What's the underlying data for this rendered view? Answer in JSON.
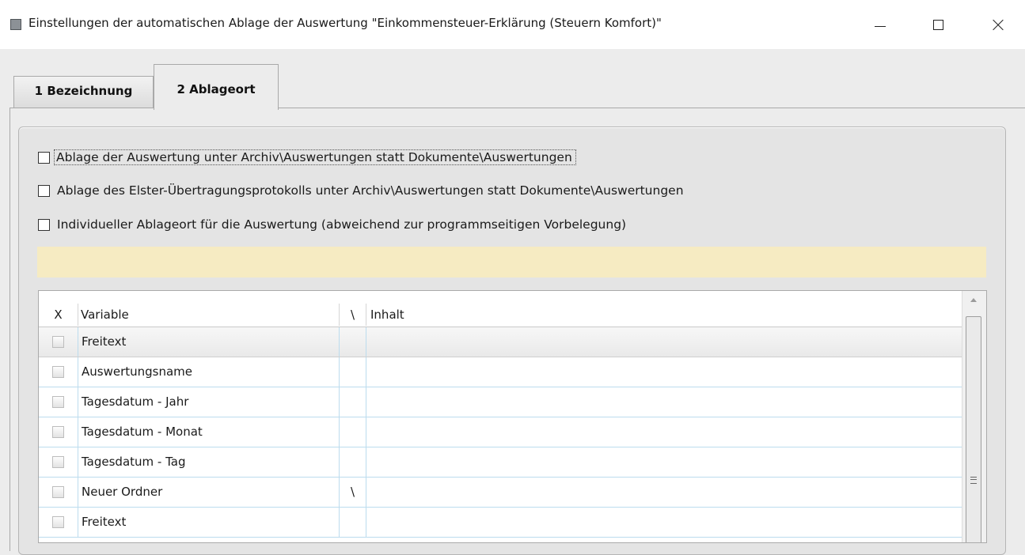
{
  "window": {
    "title": "Einstellungen der automatischen Ablage der Auswertung \"Einkommensteuer-Erklärung (Steuern Komfort)\"",
    "icon": "app-icon"
  },
  "tabs": [
    {
      "label": "1 Bezeichnung",
      "active": false
    },
    {
      "label": "2 Ablageort",
      "active": true
    }
  ],
  "options": [
    {
      "label": "Ablage der Auswertung unter Archiv\\Auswertungen statt Dokumente\\Auswertungen",
      "checked": false,
      "focused": true
    },
    {
      "label": "Ablage des Elster-Übertragungsprotokolls unter Archiv\\Auswertungen statt Dokumente\\Auswertungen",
      "checked": false
    },
    {
      "label": "Individueller Ablageort für die Auswertung (abweichend zur programmseitigen Vorbelegung)",
      "checked": false
    }
  ],
  "info_bar": {
    "text": "",
    "color": "#f6ebc2"
  },
  "table": {
    "columns": [
      "X",
      "Variable",
      "\\",
      "Inhalt"
    ],
    "rows": [
      {
        "checked": false,
        "variable": "Freitext",
        "sep": "",
        "inhalt": ""
      },
      {
        "checked": false,
        "variable": "Auswertungsname",
        "sep": "",
        "inhalt": ""
      },
      {
        "checked": false,
        "variable": "Tagesdatum - Jahr",
        "sep": "",
        "inhalt": ""
      },
      {
        "checked": false,
        "variable": "Tagesdatum - Monat",
        "sep": "",
        "inhalt": ""
      },
      {
        "checked": false,
        "variable": "Tagesdatum - Tag",
        "sep": "",
        "inhalt": ""
      },
      {
        "checked": false,
        "variable": "Neuer Ordner",
        "sep": "\\",
        "inhalt": ""
      },
      {
        "checked": false,
        "variable": "Freitext",
        "sep": "",
        "inhalt": ""
      }
    ]
  }
}
